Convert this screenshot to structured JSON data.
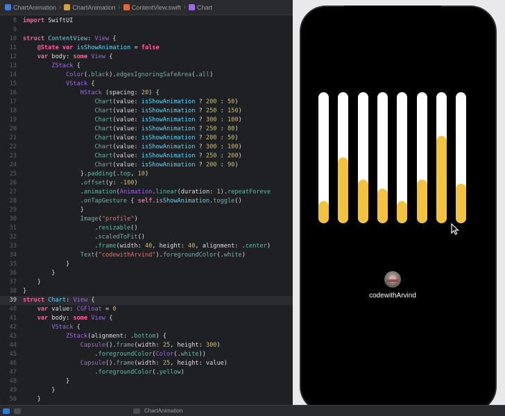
{
  "breadcrumb": [
    {
      "label": "ChartAnimation",
      "icon": "project-icon",
      "color": "#3d7fe0"
    },
    {
      "label": "ChartAnimation",
      "icon": "folder-icon",
      "color": "#d6a13c"
    },
    {
      "label": "ContentView.swift",
      "icon": "swift-file-icon",
      "color": "#e2683c"
    },
    {
      "label": "Chart",
      "icon": "struct-icon",
      "color": "#a167e6"
    }
  ],
  "code_lines": [
    {
      "n": "8",
      "t": [
        [
          "kw",
          "import"
        ],
        [
          "plain",
          " SwiftUI"
        ]
      ]
    },
    {
      "n": "9",
      "t": []
    },
    {
      "n": "10",
      "t": [
        [
          "kw",
          "struct"
        ],
        [
          "plain",
          " "
        ],
        [
          "var",
          "ContentView"
        ],
        [
          "plain",
          ": "
        ],
        [
          "type",
          "View"
        ],
        [
          "plain",
          " {"
        ]
      ]
    },
    {
      "n": "11",
      "t": [
        [
          "plain",
          "    "
        ],
        [
          "kw",
          "@State"
        ],
        [
          "plain",
          " "
        ],
        [
          "kw",
          "var"
        ],
        [
          "plain",
          " "
        ],
        [
          "var",
          "isShowAnimation"
        ],
        [
          "plain",
          " = "
        ],
        [
          "kw",
          "false"
        ]
      ]
    },
    {
      "n": "12",
      "t": [
        [
          "plain",
          "    "
        ],
        [
          "kw",
          "var"
        ],
        [
          "plain",
          " body: "
        ],
        [
          "kw",
          "some"
        ],
        [
          "plain",
          " "
        ],
        [
          "type",
          "View"
        ],
        [
          "plain",
          " {"
        ]
      ]
    },
    {
      "n": "13",
      "t": [
        [
          "plain",
          "        "
        ],
        [
          "type",
          "ZStack"
        ],
        [
          "plain",
          " {"
        ]
      ]
    },
    {
      "n": "14",
      "t": [
        [
          "plain",
          "            "
        ],
        [
          "type",
          "Color"
        ],
        [
          "plain",
          "(."
        ],
        [
          "fn",
          "black"
        ],
        [
          "plain",
          ")."
        ],
        [
          "fn",
          "edgesIgnoringSafeArea"
        ],
        [
          "plain",
          "(."
        ],
        [
          "fn",
          "all"
        ],
        [
          "plain",
          ")"
        ]
      ]
    },
    {
      "n": "15",
      "t": [
        [
          "plain",
          "            "
        ],
        [
          "type",
          "VStack"
        ],
        [
          "plain",
          " {"
        ]
      ]
    },
    {
      "n": "16",
      "t": [
        [
          "plain",
          "                "
        ],
        [
          "type",
          "HStack"
        ],
        [
          "plain",
          " (spacing: "
        ],
        [
          "num",
          "20"
        ],
        [
          "plain",
          ") {"
        ]
      ]
    },
    {
      "n": "17",
      "t": [
        [
          "plain",
          "                    "
        ],
        [
          "fn",
          "Chart"
        ],
        [
          "plain",
          "(value: "
        ],
        [
          "var",
          "isShowAnimation"
        ],
        [
          "plain",
          " ? "
        ],
        [
          "num",
          "200"
        ],
        [
          "plain",
          " : "
        ],
        [
          "num",
          "50"
        ],
        [
          "plain",
          ")"
        ]
      ]
    },
    {
      "n": "18",
      "t": [
        [
          "plain",
          "                    "
        ],
        [
          "fn",
          "Chart"
        ],
        [
          "plain",
          "(value: "
        ],
        [
          "var",
          "isShowAnimation"
        ],
        [
          "plain",
          " ? "
        ],
        [
          "num",
          "250"
        ],
        [
          "plain",
          " : "
        ],
        [
          "num",
          "150"
        ],
        [
          "plain",
          ")"
        ]
      ]
    },
    {
      "n": "19",
      "t": [
        [
          "plain",
          "                    "
        ],
        [
          "fn",
          "Chart"
        ],
        [
          "plain",
          "(value: "
        ],
        [
          "var",
          "isShowAnimation"
        ],
        [
          "plain",
          " ? "
        ],
        [
          "num",
          "300"
        ],
        [
          "plain",
          " : "
        ],
        [
          "num",
          "100"
        ],
        [
          "plain",
          ")"
        ]
      ]
    },
    {
      "n": "20",
      "t": [
        [
          "plain",
          "                    "
        ],
        [
          "fn",
          "Chart"
        ],
        [
          "plain",
          "(value: "
        ],
        [
          "var",
          "isShowAnimation"
        ],
        [
          "plain",
          " ? "
        ],
        [
          "num",
          "250"
        ],
        [
          "plain",
          " : "
        ],
        [
          "num",
          "80"
        ],
        [
          "plain",
          ")"
        ]
      ]
    },
    {
      "n": "21",
      "t": [
        [
          "plain",
          "                    "
        ],
        [
          "fn",
          "Chart"
        ],
        [
          "plain",
          "(value: "
        ],
        [
          "var",
          "isShowAnimation"
        ],
        [
          "plain",
          " ? "
        ],
        [
          "num",
          "200"
        ],
        [
          "plain",
          " : "
        ],
        [
          "num",
          "50"
        ],
        [
          "plain",
          ")"
        ]
      ]
    },
    {
      "n": "22",
      "t": [
        [
          "plain",
          "                    "
        ],
        [
          "fn",
          "Chart"
        ],
        [
          "plain",
          "(value: "
        ],
        [
          "var",
          "isShowAnimation"
        ],
        [
          "plain",
          " ? "
        ],
        [
          "num",
          "300"
        ],
        [
          "plain",
          " : "
        ],
        [
          "num",
          "100"
        ],
        [
          "plain",
          ")"
        ]
      ]
    },
    {
      "n": "23",
      "t": [
        [
          "plain",
          "                    "
        ],
        [
          "fn",
          "Chart"
        ],
        [
          "plain",
          "(value: "
        ],
        [
          "var",
          "isShowAnimation"
        ],
        [
          "plain",
          " ? "
        ],
        [
          "num",
          "250"
        ],
        [
          "plain",
          " : "
        ],
        [
          "num",
          "200"
        ],
        [
          "plain",
          ")"
        ]
      ]
    },
    {
      "n": "24",
      "t": [
        [
          "plain",
          "                    "
        ],
        [
          "fn",
          "Chart"
        ],
        [
          "plain",
          "(value: "
        ],
        [
          "var",
          "isShowAnimation"
        ],
        [
          "plain",
          " ? "
        ],
        [
          "num",
          "200"
        ],
        [
          "plain",
          " : "
        ],
        [
          "num",
          "90"
        ],
        [
          "plain",
          ")"
        ]
      ]
    },
    {
      "n": "25",
      "t": [
        [
          "plain",
          "                }."
        ],
        [
          "fn",
          "padding"
        ],
        [
          "plain",
          "(."
        ],
        [
          "fn",
          "top"
        ],
        [
          "plain",
          ", "
        ],
        [
          "num",
          "10"
        ],
        [
          "plain",
          ")"
        ]
      ]
    },
    {
      "n": "26",
      "t": [
        [
          "plain",
          "                ."
        ],
        [
          "fn",
          "offset"
        ],
        [
          "plain",
          "(y: "
        ],
        [
          "num",
          "-100"
        ],
        [
          "plain",
          ")"
        ]
      ]
    },
    {
      "n": "27",
      "t": [
        [
          "plain",
          "                ."
        ],
        [
          "fn",
          "animation"
        ],
        [
          "plain",
          "("
        ],
        [
          "type",
          "Animation"
        ],
        [
          "plain",
          "."
        ],
        [
          "fn",
          "linear"
        ],
        [
          "plain",
          "(duration: "
        ],
        [
          "num",
          "1"
        ],
        [
          "plain",
          ")."
        ],
        [
          "fn",
          "repeatForeve"
        ]
      ]
    },
    {
      "n": "28",
      "t": [
        [
          "plain",
          "                ."
        ],
        [
          "fn",
          "onTapGesture"
        ],
        [
          "plain",
          " { "
        ],
        [
          "kw",
          "self"
        ],
        [
          "plain",
          "."
        ],
        [
          "var",
          "isShowAnimation"
        ],
        [
          "plain",
          "."
        ],
        [
          "fn",
          "toggle"
        ],
        [
          "plain",
          "()"
        ]
      ]
    },
    {
      "n": "29",
      "t": [
        [
          "plain",
          "                }"
        ]
      ]
    },
    {
      "n": "30",
      "t": [
        [
          "plain",
          "                "
        ],
        [
          "fn",
          "Image"
        ],
        [
          "plain",
          "("
        ],
        [
          "str",
          "\"profile\""
        ],
        [
          "plain",
          ")"
        ]
      ]
    },
    {
      "n": "31",
      "t": [
        [
          "plain",
          "                    ."
        ],
        [
          "fn",
          "resizable"
        ],
        [
          "plain",
          "()"
        ]
      ]
    },
    {
      "n": "32",
      "t": [
        [
          "plain",
          "                    ."
        ],
        [
          "fn",
          "scaledToFit"
        ],
        [
          "plain",
          "()"
        ]
      ]
    },
    {
      "n": "33",
      "t": [
        [
          "plain",
          "                    ."
        ],
        [
          "fn",
          "frame"
        ],
        [
          "plain",
          "(width: "
        ],
        [
          "num",
          "40"
        ],
        [
          "plain",
          ", height: "
        ],
        [
          "num",
          "40"
        ],
        [
          "plain",
          ", alignment: ."
        ],
        [
          "fn",
          "center"
        ],
        [
          "plain",
          ")"
        ]
      ]
    },
    {
      "n": "34",
      "t": [
        [
          "plain",
          "                "
        ],
        [
          "fn",
          "Text"
        ],
        [
          "plain",
          "("
        ],
        [
          "str",
          "\"codewithArvind\""
        ],
        [
          "plain",
          ")."
        ],
        [
          "fn",
          "foregroundColor"
        ],
        [
          "plain",
          "(."
        ],
        [
          "fn",
          "white"
        ],
        [
          "plain",
          ")"
        ]
      ]
    },
    {
      "n": "35",
      "t": [
        [
          "plain",
          "            }"
        ]
      ]
    },
    {
      "n": "36",
      "t": [
        [
          "plain",
          "        }"
        ]
      ]
    },
    {
      "n": "37",
      "t": [
        [
          "plain",
          "    }"
        ]
      ]
    },
    {
      "n": "38",
      "t": [
        [
          "plain",
          "}"
        ]
      ]
    },
    {
      "n": "39",
      "t": [
        [
          "kw",
          "struct"
        ],
        [
          "plain",
          " "
        ],
        [
          "var",
          "Chart"
        ],
        [
          "plain",
          ": "
        ],
        [
          "type",
          "View"
        ],
        [
          "plain",
          " {"
        ]
      ],
      "current": true
    },
    {
      "n": "40",
      "t": [
        [
          "plain",
          "    "
        ],
        [
          "kw",
          "var"
        ],
        [
          "plain",
          " value: "
        ],
        [
          "type",
          "CGFloat"
        ],
        [
          "plain",
          " = "
        ],
        [
          "num",
          "0"
        ]
      ]
    },
    {
      "n": "41",
      "t": [
        [
          "plain",
          "    "
        ],
        [
          "kw",
          "var"
        ],
        [
          "plain",
          " body: "
        ],
        [
          "kw",
          "some"
        ],
        [
          "plain",
          " "
        ],
        [
          "type",
          "View"
        ],
        [
          "plain",
          " {"
        ]
      ]
    },
    {
      "n": "42",
      "t": [
        [
          "plain",
          "        "
        ],
        [
          "type",
          "VStack"
        ],
        [
          "plain",
          " {"
        ]
      ]
    },
    {
      "n": "43",
      "t": [
        [
          "plain",
          "            "
        ],
        [
          "type",
          "ZStack"
        ],
        [
          "plain",
          "(alignment: ."
        ],
        [
          "fn",
          "bottom"
        ],
        [
          "plain",
          ") {"
        ]
      ]
    },
    {
      "n": "44",
      "t": [
        [
          "plain",
          "                "
        ],
        [
          "type",
          "Capsule"
        ],
        [
          "plain",
          "()."
        ],
        [
          "fn",
          "frame"
        ],
        [
          "plain",
          "(width: "
        ],
        [
          "num",
          "25"
        ],
        [
          "plain",
          ", height: "
        ],
        [
          "num",
          "300"
        ],
        [
          "plain",
          ")"
        ]
      ]
    },
    {
      "n": "45",
      "t": [
        [
          "plain",
          "                    ."
        ],
        [
          "fn",
          "foregroundColor"
        ],
        [
          "plain",
          "("
        ],
        [
          "type",
          "Color"
        ],
        [
          "plain",
          "(."
        ],
        [
          "fn",
          "white"
        ],
        [
          "plain",
          "))"
        ]
      ]
    },
    {
      "n": "46",
      "t": [
        [
          "plain",
          "                "
        ],
        [
          "type",
          "Capsule"
        ],
        [
          "plain",
          "()."
        ],
        [
          "fn",
          "frame"
        ],
        [
          "plain",
          "(width: "
        ],
        [
          "num",
          "25"
        ],
        [
          "plain",
          ", height: value)"
        ]
      ]
    },
    {
      "n": "47",
      "t": [
        [
          "plain",
          "                    ."
        ],
        [
          "fn",
          "foregroundColor"
        ],
        [
          "plain",
          "(."
        ],
        [
          "fn",
          "yellow"
        ],
        [
          "plain",
          ")"
        ]
      ]
    },
    {
      "n": "48",
      "t": [
        [
          "plain",
          "            }"
        ]
      ]
    },
    {
      "n": "49",
      "t": [
        [
          "plain",
          "        }"
        ]
      ]
    },
    {
      "n": "50",
      "t": [
        [
          "plain",
          "    }"
        ]
      ]
    }
  ],
  "preview": {
    "bars": [
      {
        "fill_fraction": 0.167
      },
      {
        "fill_fraction": 0.5
      },
      {
        "fill_fraction": 0.333
      },
      {
        "fill_fraction": 0.267
      },
      {
        "fill_fraction": 0.167
      },
      {
        "fill_fraction": 0.333
      },
      {
        "fill_fraction": 0.667
      },
      {
        "fill_fraction": 0.3
      }
    ],
    "track_color": "#ffffff",
    "fill_color": "#f3c33d",
    "avatar_icon": "profile-avatar",
    "username": "codewithArvind"
  },
  "status_bar": {
    "scheme": "ChartAnimation",
    "icons": [
      "sidebar-toggle-icon",
      "filter-icon",
      "scheme-icon"
    ]
  }
}
